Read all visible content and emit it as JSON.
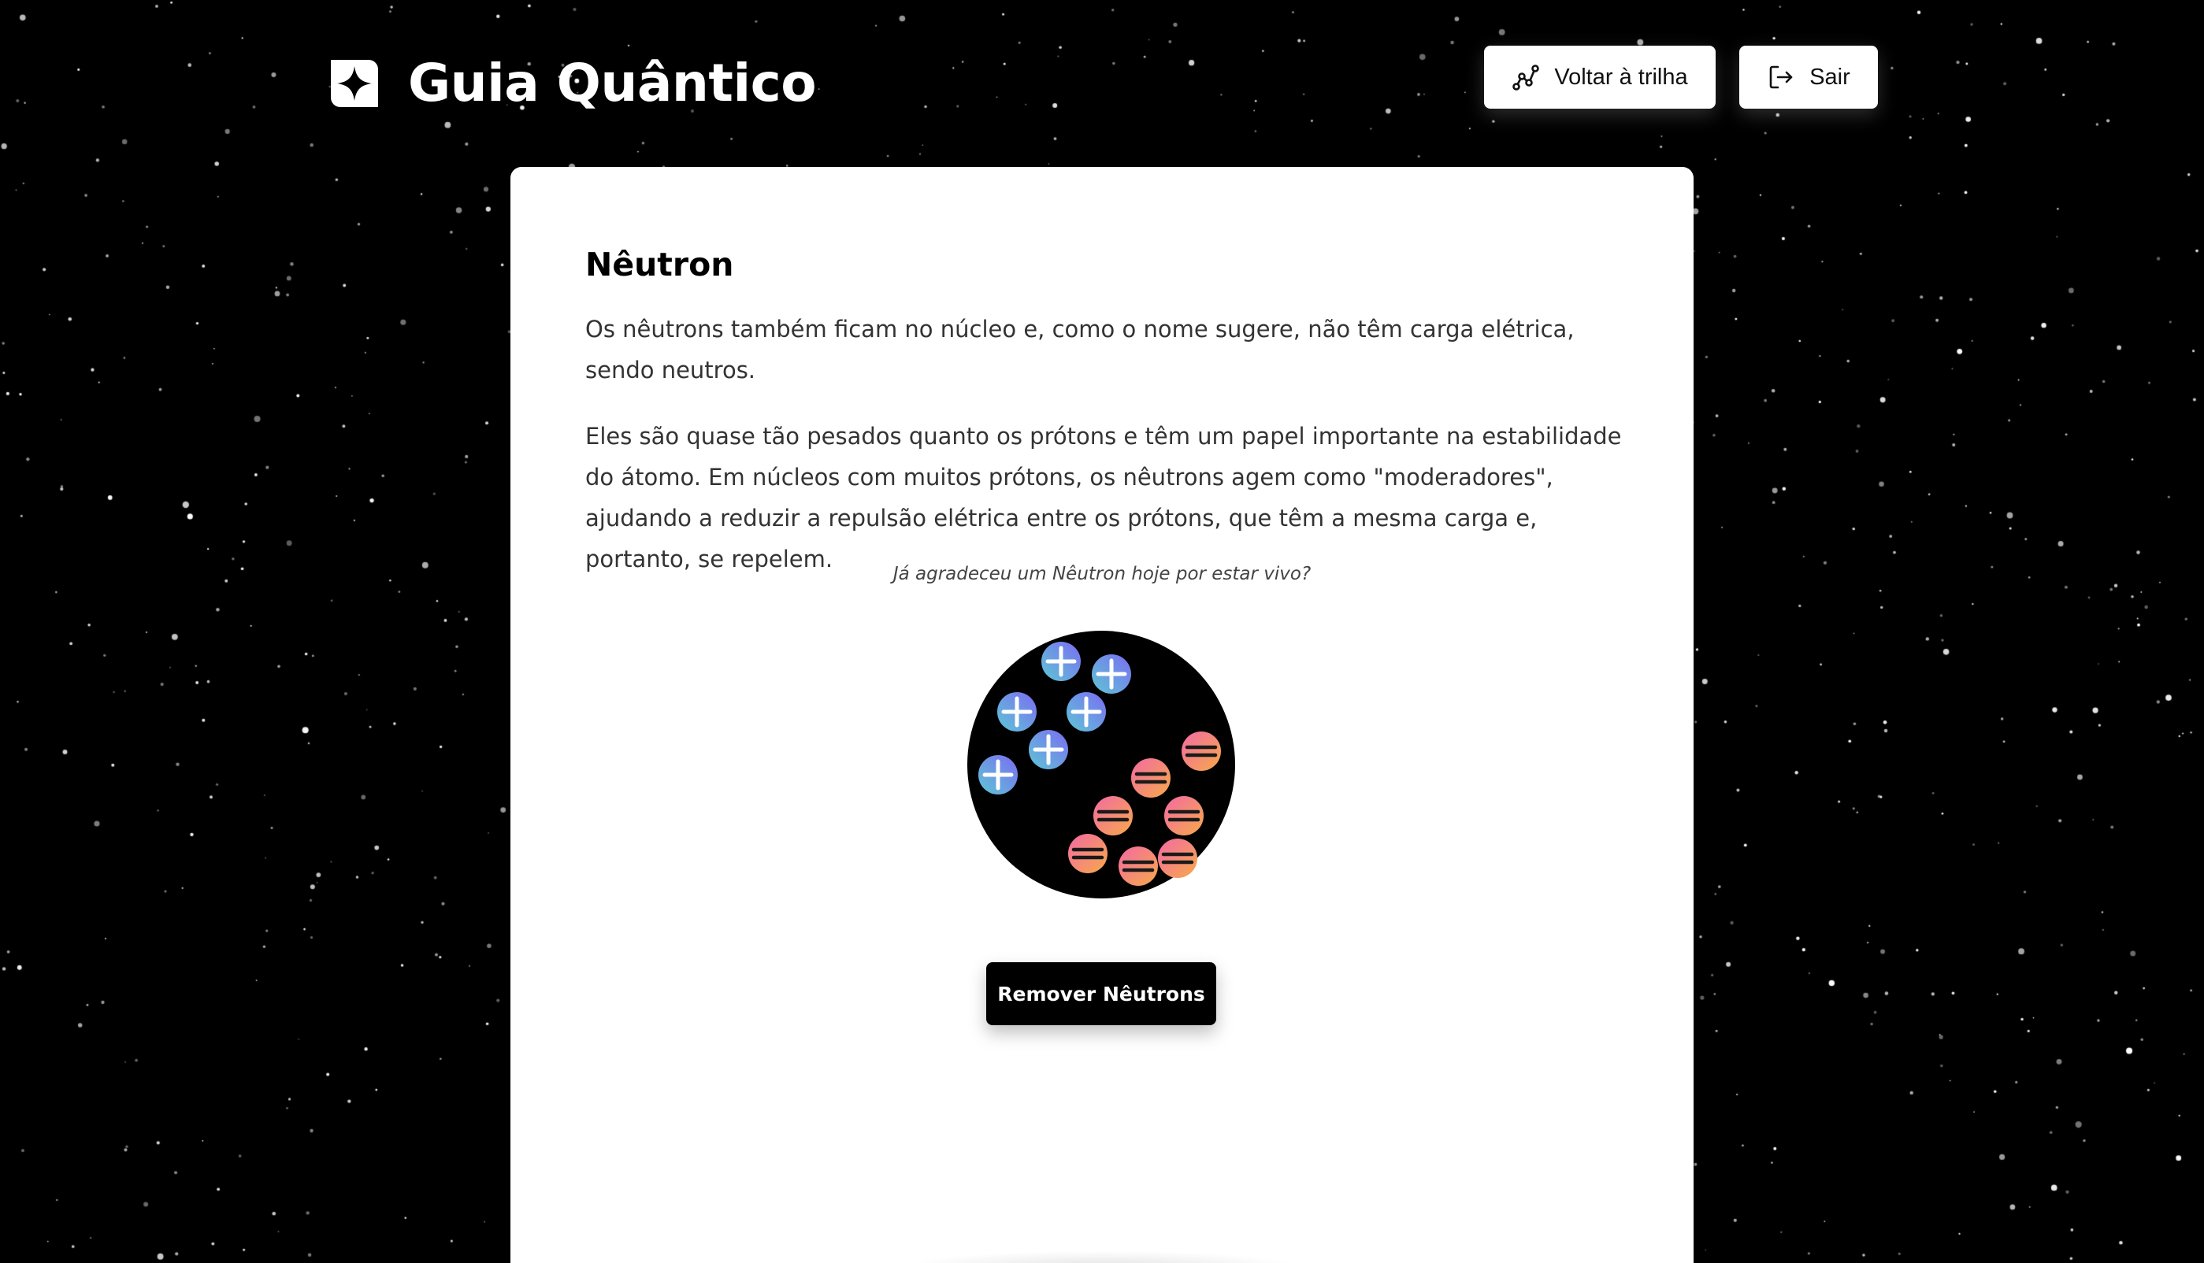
{
  "header": {
    "brand_icon": "sparkle-logo-icon",
    "title": "Guia Quântico",
    "buttons": [
      {
        "label": "Voltar à trilha",
        "icon": "trail-path-icon"
      },
      {
        "label": "Sair",
        "icon": "logout-icon"
      }
    ]
  },
  "main": {
    "title": "Nêutron",
    "paragraphs": [
      "Os nêutrons também ficam no núcleo e, como o nome sugere, não têm carga elétrica, sendo neutros.",
      "Eles são quase tão pesados quanto os prótons e têm um papel importante na estabilidade do átomo. Em núcleos com muitos prótons, os nêutrons agem como \"moderadores\", ajudando a reduzir a repulsão elétrica entre os prótons, que têm a mesma carga e, portanto, se repelem."
    ],
    "quote": "Já agradeceu um Nêutron hoje por estar vivo?",
    "nucleus": {
      "proton_count": 6,
      "neutron_count": 7,
      "proton_icon": "plus-icon",
      "neutron_icon": "equals-icon"
    },
    "action_button": "Remover Nêutrons"
  },
  "colors": {
    "background": "#000000",
    "card": "#ffffff",
    "proton_gradient": [
      "#5ec7d6",
      "#7b6cf2"
    ],
    "neutron_gradient": [
      "#f36aa3",
      "#f6a94a"
    ]
  }
}
